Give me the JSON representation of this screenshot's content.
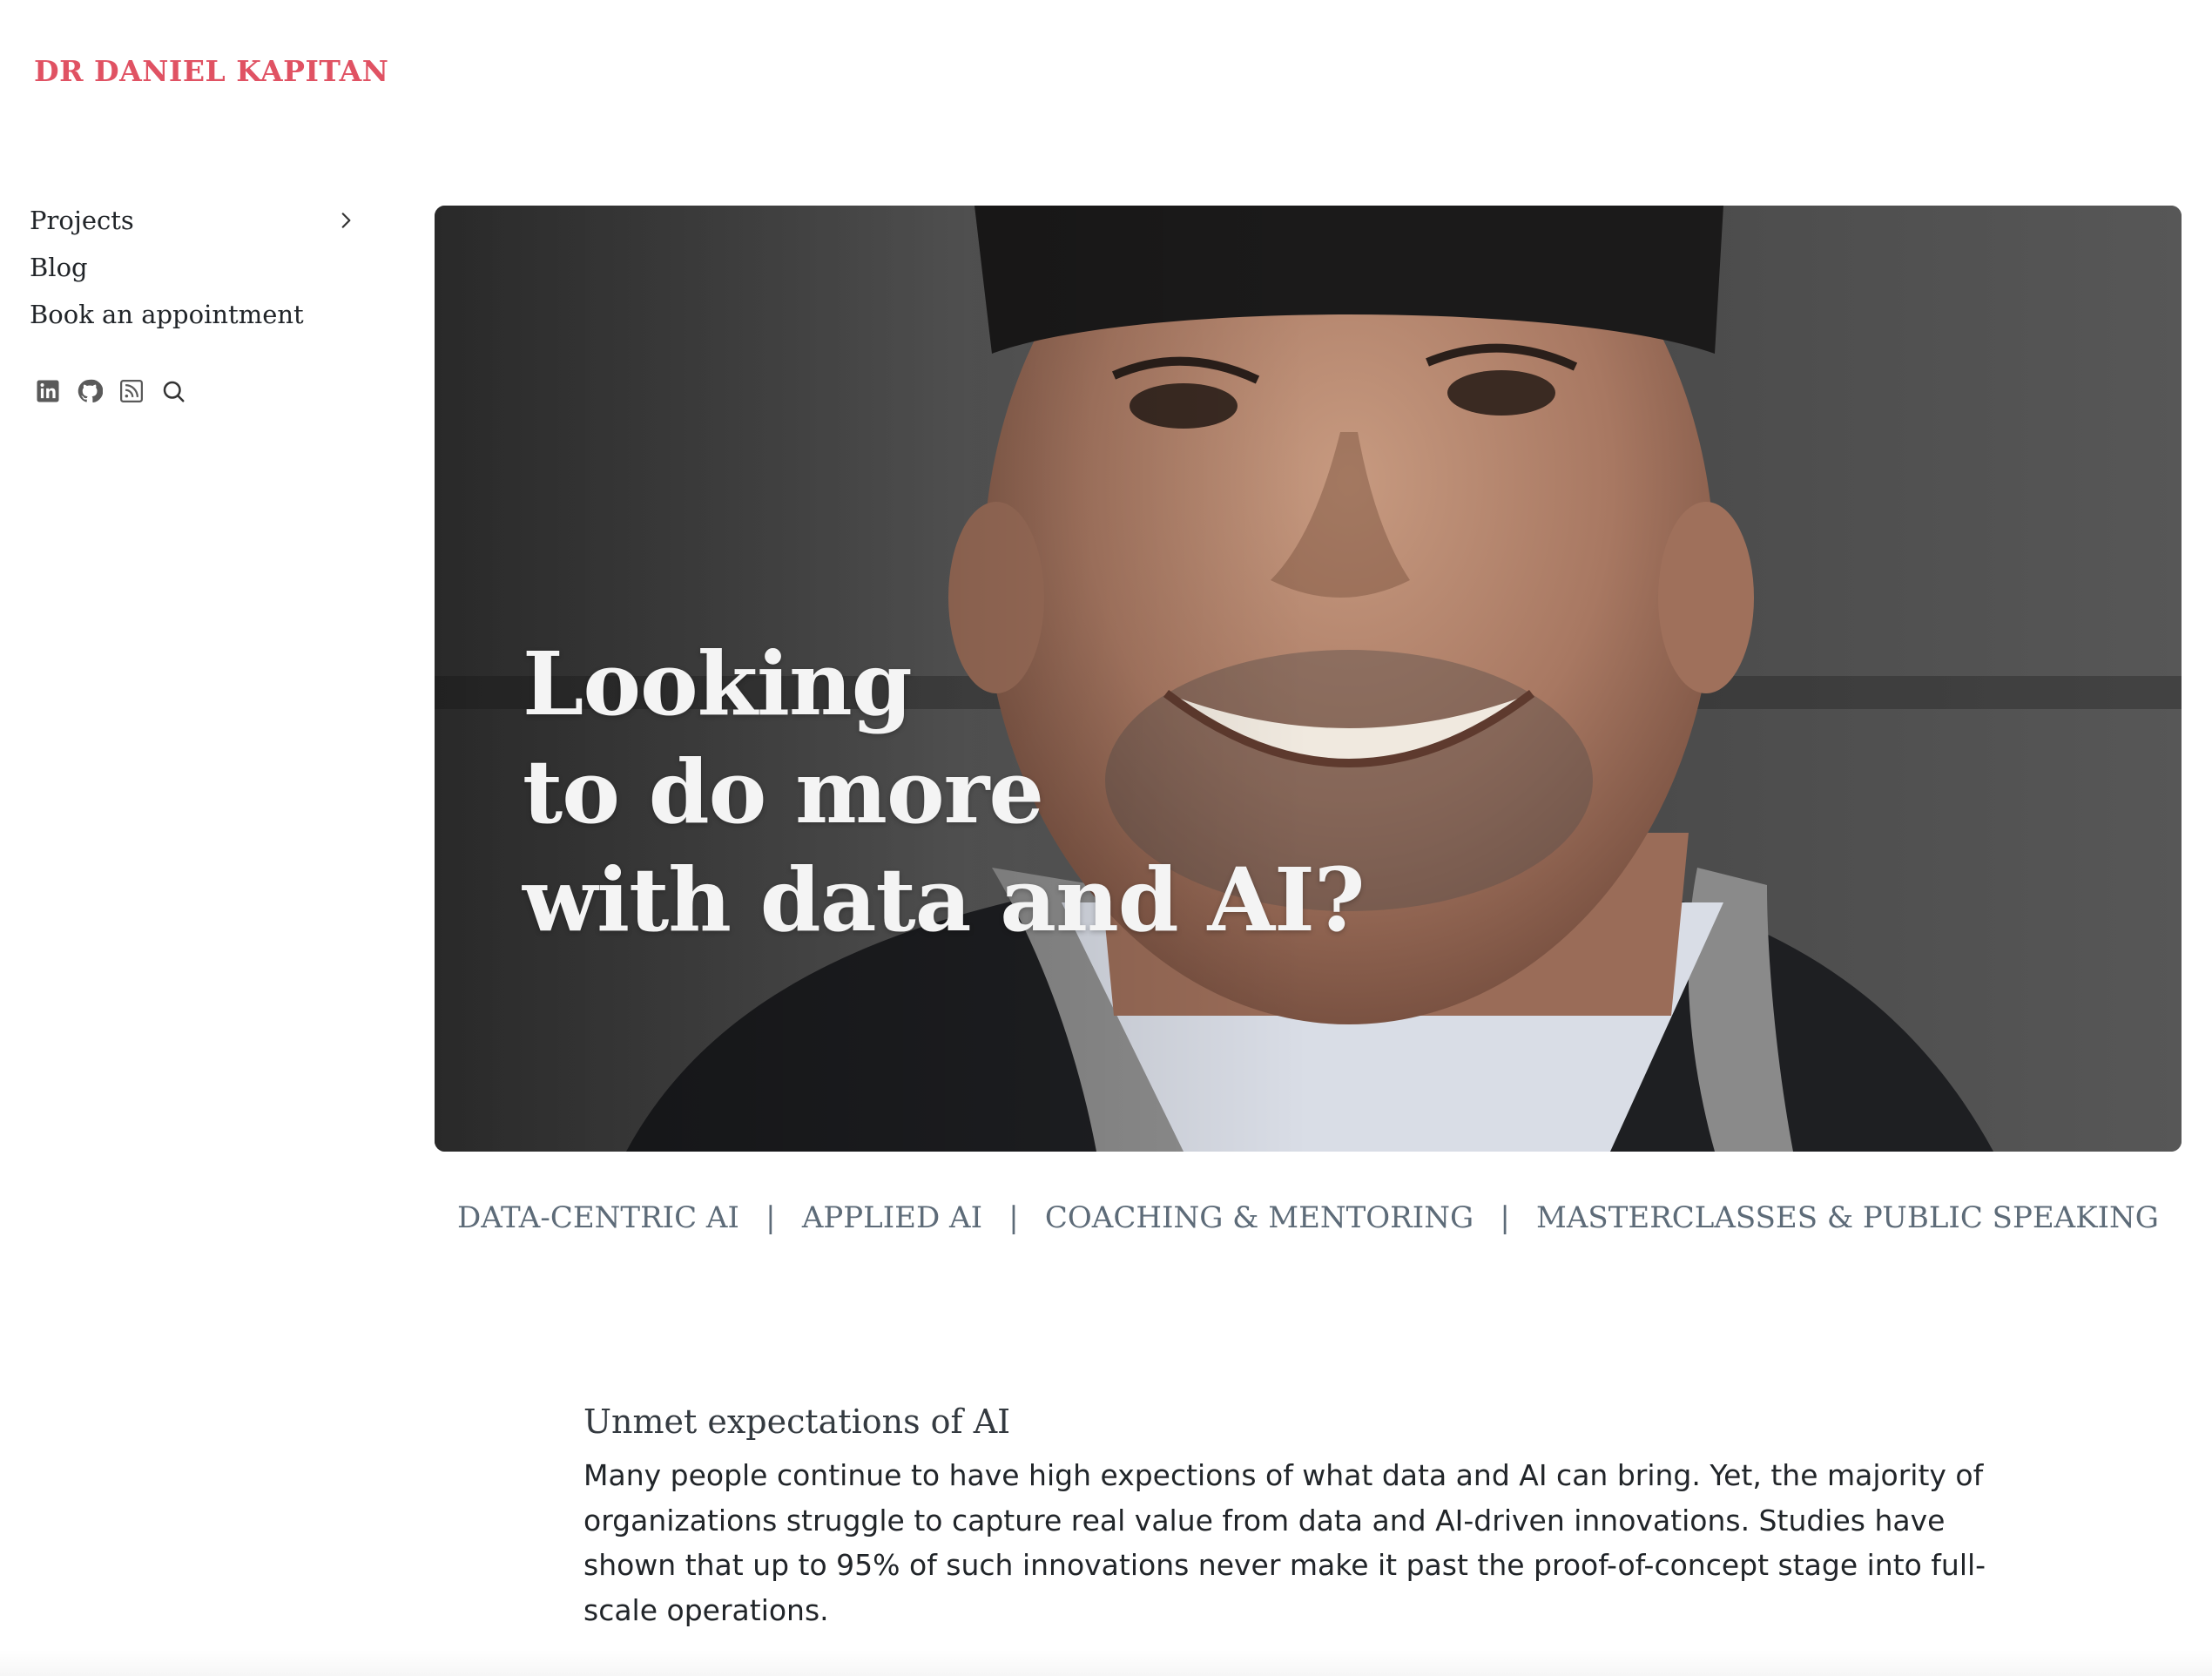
{
  "brand": {
    "name": "DR DANIEL KAPITAN",
    "color": "#e05263"
  },
  "nav": {
    "items": [
      {
        "label": "Projects",
        "icon": "chevron-right-icon"
      },
      {
        "label": "Blog"
      },
      {
        "label": "Book an appointment"
      }
    ]
  },
  "social": {
    "icons": [
      "linkedin-icon",
      "github-icon",
      "rss-icon",
      "search-icon"
    ]
  },
  "hero": {
    "title_lines": [
      "Looking",
      "to do more",
      "with data and AI?"
    ],
    "image": "portrait-photo"
  },
  "services": {
    "items": [
      "DATA-CENTRIC AI",
      "APPLIED AI",
      "COACHING & MENTORING",
      "MASTERCLASSES & PUBLIC SPEAKING"
    ],
    "separator": "|",
    "color": "#5d6b78"
  },
  "section": {
    "heading": "Unmet expectations of AI",
    "body": "Many people continue to have high expections of what data and AI can bring. Yet, the majority of organizations struggle to capture real value from data and AI-driven innovations. Studies have shown that up to 95% of such innovations never make it past the proof-of-concept stage into full-scale operations."
  }
}
